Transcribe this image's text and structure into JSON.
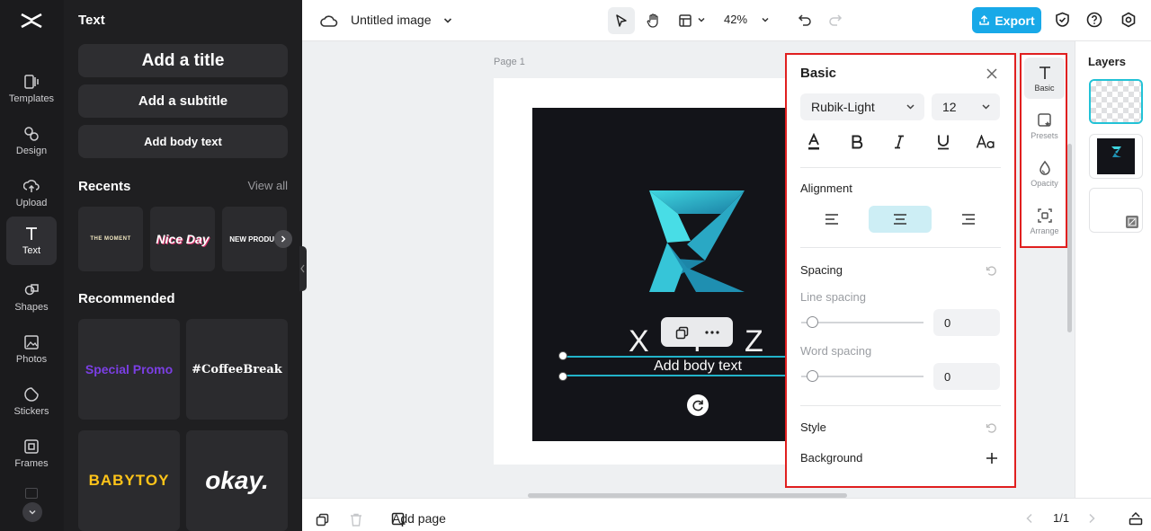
{
  "rail": {
    "items": [
      {
        "label": "Templates",
        "icon": "templates-icon"
      },
      {
        "label": "Design",
        "icon": "design-icon"
      },
      {
        "label": "Upload",
        "icon": "upload-icon"
      },
      {
        "label": "Text",
        "icon": "text-icon",
        "active": true
      },
      {
        "label": "Shapes",
        "icon": "shapes-icon"
      },
      {
        "label": "Photos",
        "icon": "photos-icon"
      },
      {
        "label": "Stickers",
        "icon": "stickers-icon"
      },
      {
        "label": "Frames",
        "icon": "frames-icon"
      }
    ]
  },
  "text_panel": {
    "title": "Text",
    "add_title": "Add a title",
    "add_subtitle": "Add a subtitle",
    "add_body": "Add body text",
    "recents_label": "Recents",
    "view_all": "View all",
    "recents": [
      "THE MOMENT",
      "Nice Day",
      "NEW PRODUC"
    ],
    "recommended_label": "Recommended",
    "recommended": [
      "Special Promo",
      "#CoffeeBreak",
      "BABYTOY",
      "okay."
    ]
  },
  "topbar": {
    "doc_title": "Untitled image",
    "zoom": "42%",
    "export_label": "Export"
  },
  "canvas": {
    "page_label": "Page 1",
    "logo_letters": [
      "X",
      "Y",
      "Z"
    ],
    "selected_text": "Add body text"
  },
  "props": {
    "title": "Basic",
    "font_family": "Rubik-Light",
    "font_size": "12",
    "alignment_label": "Alignment",
    "spacing_label": "Spacing",
    "line_spacing_label": "Line spacing",
    "line_spacing_value": "0",
    "word_spacing_label": "Word spacing",
    "word_spacing_value": "0",
    "style_label": "Style",
    "background_label": "Background"
  },
  "tabs": [
    {
      "label": "Basic",
      "active": true
    },
    {
      "label": "Presets"
    },
    {
      "label": "Opacity"
    },
    {
      "label": "Arrange"
    }
  ],
  "layers": {
    "title": "Layers"
  },
  "bottombar": {
    "add_page": "Add page",
    "page_indicator": "1/1"
  },
  "colors": {
    "accent": "#18a9e8",
    "selection": "#22b3c9",
    "highlight_border": "#e01f1f"
  }
}
